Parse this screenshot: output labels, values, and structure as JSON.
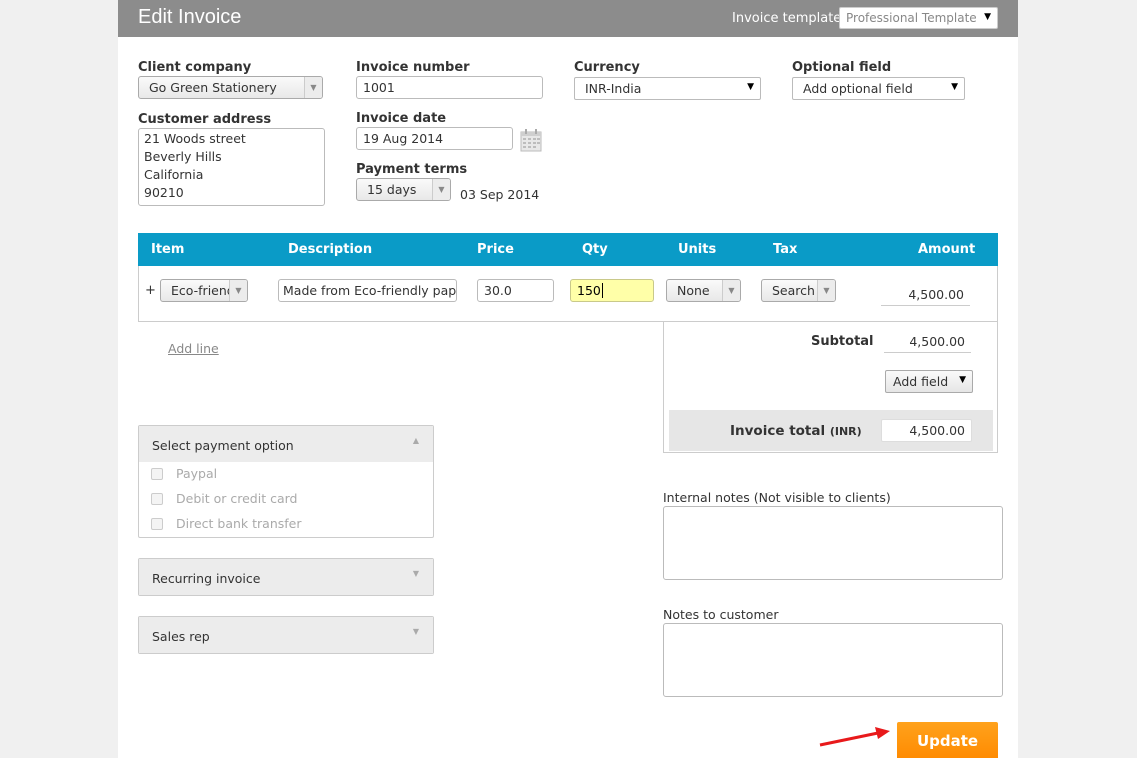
{
  "header": {
    "title": "Edit Invoice",
    "template_label": "Invoice template",
    "template_value": "Professional Template"
  },
  "client": {
    "label": "Client company",
    "value": "Go Green Stationery"
  },
  "address": {
    "label": "Customer address",
    "lines": [
      "21 Woods street",
      "Beverly Hills",
      "California",
      "90210"
    ]
  },
  "invoice_number": {
    "label": "Invoice number",
    "value": "1001"
  },
  "invoice_date": {
    "label": "Invoice date",
    "value": "19 Aug 2014"
  },
  "payment_terms": {
    "label": "Payment terms",
    "value": "15 days",
    "due_date": "03 Sep 2014"
  },
  "currency": {
    "label": "Currency",
    "value": "INR-India"
  },
  "optional_field": {
    "label": "Optional field",
    "value": "Add optional field"
  },
  "table": {
    "headers": [
      "Item",
      "Description",
      "Price",
      "Qty",
      "Units",
      "Tax",
      "Amount"
    ],
    "row": {
      "plus": "+",
      "item": "Eco-friendly",
      "description": "Made from Eco-friendly paper",
      "price": "30.0",
      "qty": "150",
      "units": "None",
      "tax": "Search",
      "amount": "4,500.00"
    }
  },
  "add_line": "Add line",
  "totals": {
    "subtotal_label": "Subtotal",
    "subtotal_value": "4,500.00",
    "add_field": "Add field",
    "total_label": "Invoice total",
    "total_currency": "(INR)",
    "total_value": "4,500.00"
  },
  "payment": {
    "title": "Select payment option",
    "options": [
      "Paypal",
      "Debit or credit card",
      "Direct bank transfer"
    ]
  },
  "recurring": {
    "title": "Recurring invoice"
  },
  "sales_rep": {
    "title": "Sales rep"
  },
  "internal_notes": {
    "label": "Internal notes (Not visible to clients)"
  },
  "customer_notes": {
    "label": "Notes to customer"
  },
  "update_button": "Update",
  "colors": {
    "header_bg": "#8c8c8c",
    "table_header_bg": "#0a9bc7",
    "update_bg": "#ff8a00",
    "qty_highlight": "#ffffa8",
    "annotation_arrow": "#e8191b"
  }
}
